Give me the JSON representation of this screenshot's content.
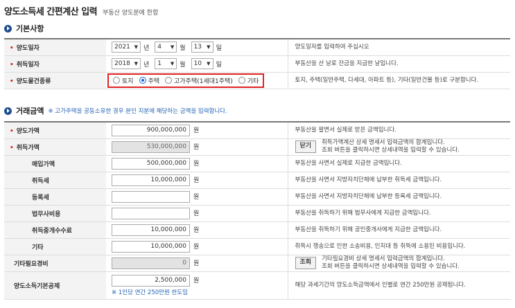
{
  "title": {
    "main": "양도소득세 간편계산 입력",
    "sub": "부동산 양도분에 한함"
  },
  "section1": {
    "label": "기본사항"
  },
  "basic": {
    "transfer_date": {
      "label": "양도일자",
      "year": "2021",
      "month": "4",
      "day": "13",
      "desc": "양도일자를 입력하여 주십시오"
    },
    "acquisition_date": {
      "label": "취득일자",
      "year": "2018",
      "month": "1",
      "day": "10",
      "desc": "부동산을 산 날로 잔금을 지급한 날입니다."
    },
    "units": {
      "year": "년",
      "month": "월",
      "day": "일"
    },
    "property_type": {
      "label": "양도물건종류",
      "options": [
        "토지",
        "주택",
        "고가주택(1세대1주택)",
        "기타"
      ],
      "selected": "주택",
      "desc": "토지, 주택(일반주택, 다세대, 아파트 등), 기타(일반건물 등)로 구분합니다."
    }
  },
  "section2": {
    "label": "거래금액",
    "note": "※ 고가주택을 공동소유한 경우 본인 지분에 해당하는 금액을 입력합니다."
  },
  "currency_unit": "원",
  "amounts": {
    "transfer_price": {
      "label": "양도가액",
      "value": "900,000,000",
      "desc": "부동산을 팔면서 실제로 받은 금액입니다."
    },
    "acquisition_price": {
      "label": "취득가액",
      "value": "530,000,000",
      "button": "닫기",
      "desc1": "취득가액계산 상세 명세서 입력금액의 합계입니다.",
      "desc2": "조회 버튼을 클릭하시면 상세내역을 입력할 수 있습니다."
    },
    "purchase_price": {
      "label": "매입가액",
      "value": "500,000,000",
      "desc": "부동산을 사면서 실제로 지급한 금액입니다."
    },
    "acquisition_tax": {
      "label": "취득세",
      "value": "10,000,000",
      "desc": "부동산을 사면서 지방자치단체에 납부한 취득세 금액입니다."
    },
    "registration_tax": {
      "label": "등록세",
      "value": "",
      "desc": "부동산을 사면서 지방자치단체에 납부한 등록세 금액입니다."
    },
    "legal_fee": {
      "label": "법무사비용",
      "value": "",
      "desc": "부동산을 취득하기 위해 법무사에게 지급한 금액입니다."
    },
    "brokerage_fee": {
      "label": "취득중개수수료",
      "value": "10,000,000",
      "desc": "부동산을 취득하기 위해 공인중개사에게 지급한 금액입니다."
    },
    "other": {
      "label": "기타",
      "value": "10,000,000",
      "desc": "취득시 쟁송으로 인한 소송비용, 인지대 등 취득에 소용된 비용입니다."
    },
    "other_expenses": {
      "label": "기타필요경비",
      "value": "0",
      "button": "조회",
      "desc1": "기타필요경비 상세 명세서 입력금액의 합계입니다.",
      "desc2": "조회 버튼을 클릭하시면 상세내역을 입력할 수 있습니다."
    },
    "basic_deduction": {
      "label": "양도소득기본공제",
      "value": "2,500,000",
      "hint": "※ 1인당 연간 250만원 한도임",
      "desc": "해당 과세기간의 양도소득금액에서 인별로 연간 250만원 공제됩니다."
    }
  }
}
